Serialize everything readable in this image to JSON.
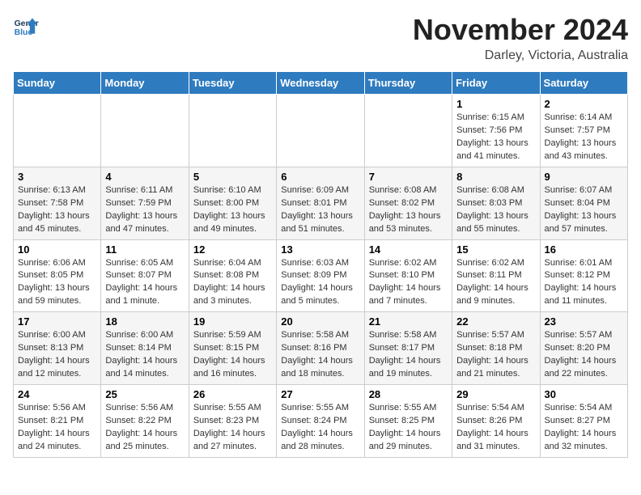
{
  "header": {
    "logo_line1": "General",
    "logo_line2": "Blue",
    "month": "November 2024",
    "location": "Darley, Victoria, Australia"
  },
  "weekdays": [
    "Sunday",
    "Monday",
    "Tuesday",
    "Wednesday",
    "Thursday",
    "Friday",
    "Saturday"
  ],
  "weeks": [
    [
      {
        "day": "",
        "info": ""
      },
      {
        "day": "",
        "info": ""
      },
      {
        "day": "",
        "info": ""
      },
      {
        "day": "",
        "info": ""
      },
      {
        "day": "",
        "info": ""
      },
      {
        "day": "1",
        "info": "Sunrise: 6:15 AM\nSunset: 7:56 PM\nDaylight: 13 hours\nand 41 minutes."
      },
      {
        "day": "2",
        "info": "Sunrise: 6:14 AM\nSunset: 7:57 PM\nDaylight: 13 hours\nand 43 minutes."
      }
    ],
    [
      {
        "day": "3",
        "info": "Sunrise: 6:13 AM\nSunset: 7:58 PM\nDaylight: 13 hours\nand 45 minutes."
      },
      {
        "day": "4",
        "info": "Sunrise: 6:11 AM\nSunset: 7:59 PM\nDaylight: 13 hours\nand 47 minutes."
      },
      {
        "day": "5",
        "info": "Sunrise: 6:10 AM\nSunset: 8:00 PM\nDaylight: 13 hours\nand 49 minutes."
      },
      {
        "day": "6",
        "info": "Sunrise: 6:09 AM\nSunset: 8:01 PM\nDaylight: 13 hours\nand 51 minutes."
      },
      {
        "day": "7",
        "info": "Sunrise: 6:08 AM\nSunset: 8:02 PM\nDaylight: 13 hours\nand 53 minutes."
      },
      {
        "day": "8",
        "info": "Sunrise: 6:08 AM\nSunset: 8:03 PM\nDaylight: 13 hours\nand 55 minutes."
      },
      {
        "day": "9",
        "info": "Sunrise: 6:07 AM\nSunset: 8:04 PM\nDaylight: 13 hours\nand 57 minutes."
      }
    ],
    [
      {
        "day": "10",
        "info": "Sunrise: 6:06 AM\nSunset: 8:05 PM\nDaylight: 13 hours\nand 59 minutes."
      },
      {
        "day": "11",
        "info": "Sunrise: 6:05 AM\nSunset: 8:07 PM\nDaylight: 14 hours\nand 1 minute."
      },
      {
        "day": "12",
        "info": "Sunrise: 6:04 AM\nSunset: 8:08 PM\nDaylight: 14 hours\nand 3 minutes."
      },
      {
        "day": "13",
        "info": "Sunrise: 6:03 AM\nSunset: 8:09 PM\nDaylight: 14 hours\nand 5 minutes."
      },
      {
        "day": "14",
        "info": "Sunrise: 6:02 AM\nSunset: 8:10 PM\nDaylight: 14 hours\nand 7 minutes."
      },
      {
        "day": "15",
        "info": "Sunrise: 6:02 AM\nSunset: 8:11 PM\nDaylight: 14 hours\nand 9 minutes."
      },
      {
        "day": "16",
        "info": "Sunrise: 6:01 AM\nSunset: 8:12 PM\nDaylight: 14 hours\nand 11 minutes."
      }
    ],
    [
      {
        "day": "17",
        "info": "Sunrise: 6:00 AM\nSunset: 8:13 PM\nDaylight: 14 hours\nand 12 minutes."
      },
      {
        "day": "18",
        "info": "Sunrise: 6:00 AM\nSunset: 8:14 PM\nDaylight: 14 hours\nand 14 minutes."
      },
      {
        "day": "19",
        "info": "Sunrise: 5:59 AM\nSunset: 8:15 PM\nDaylight: 14 hours\nand 16 minutes."
      },
      {
        "day": "20",
        "info": "Sunrise: 5:58 AM\nSunset: 8:16 PM\nDaylight: 14 hours\nand 18 minutes."
      },
      {
        "day": "21",
        "info": "Sunrise: 5:58 AM\nSunset: 8:17 PM\nDaylight: 14 hours\nand 19 minutes."
      },
      {
        "day": "22",
        "info": "Sunrise: 5:57 AM\nSunset: 8:18 PM\nDaylight: 14 hours\nand 21 minutes."
      },
      {
        "day": "23",
        "info": "Sunrise: 5:57 AM\nSunset: 8:20 PM\nDaylight: 14 hours\nand 22 minutes."
      }
    ],
    [
      {
        "day": "24",
        "info": "Sunrise: 5:56 AM\nSunset: 8:21 PM\nDaylight: 14 hours\nand 24 minutes."
      },
      {
        "day": "25",
        "info": "Sunrise: 5:56 AM\nSunset: 8:22 PM\nDaylight: 14 hours\nand 25 minutes."
      },
      {
        "day": "26",
        "info": "Sunrise: 5:55 AM\nSunset: 8:23 PM\nDaylight: 14 hours\nand 27 minutes."
      },
      {
        "day": "27",
        "info": "Sunrise: 5:55 AM\nSunset: 8:24 PM\nDaylight: 14 hours\nand 28 minutes."
      },
      {
        "day": "28",
        "info": "Sunrise: 5:55 AM\nSunset: 8:25 PM\nDaylight: 14 hours\nand 29 minutes."
      },
      {
        "day": "29",
        "info": "Sunrise: 5:54 AM\nSunset: 8:26 PM\nDaylight: 14 hours\nand 31 minutes."
      },
      {
        "day": "30",
        "info": "Sunrise: 5:54 AM\nSunset: 8:27 PM\nDaylight: 14 hours\nand 32 minutes."
      }
    ]
  ]
}
